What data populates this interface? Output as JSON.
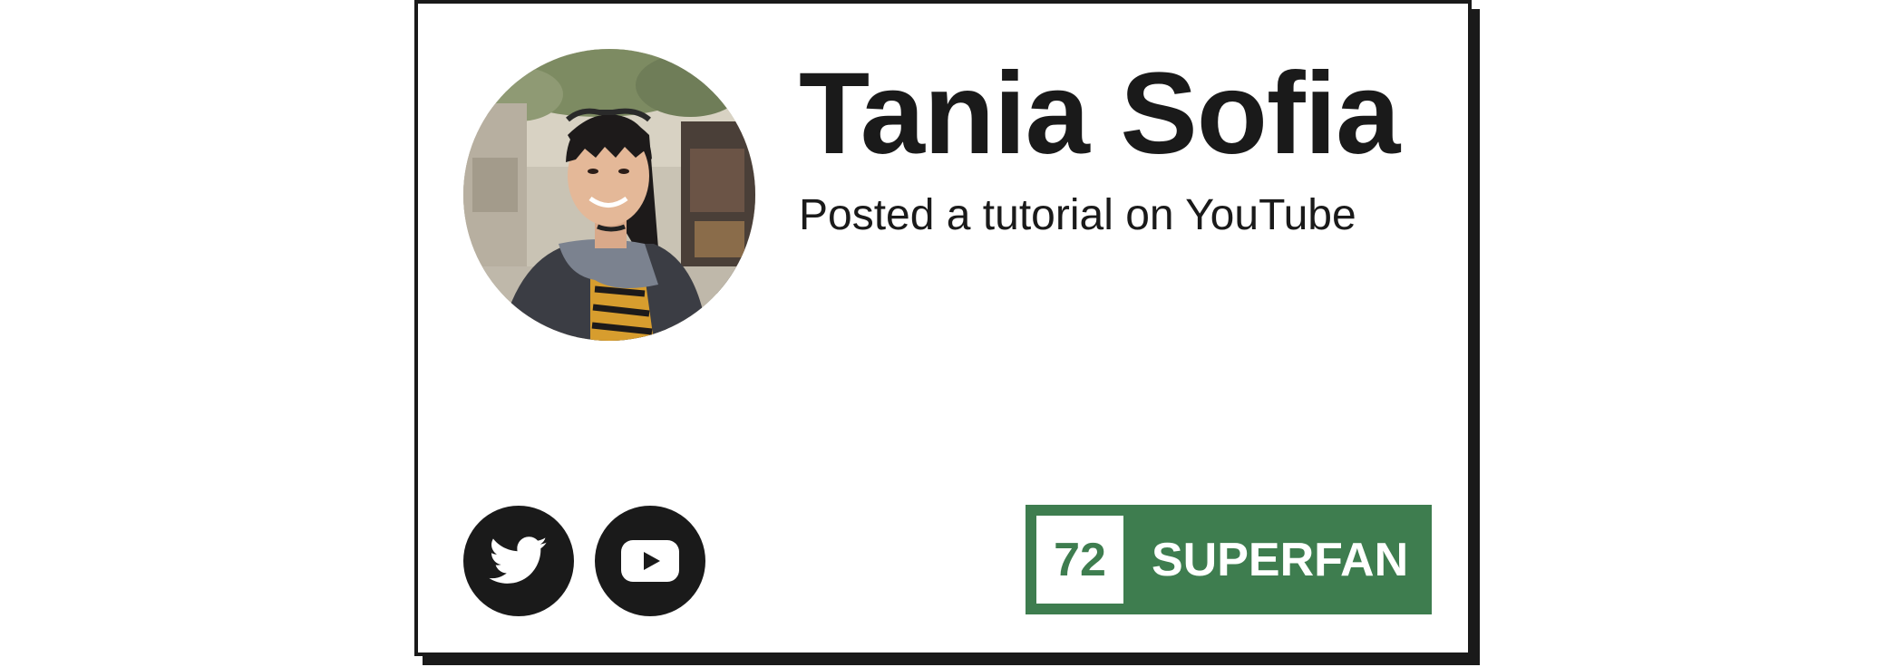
{
  "card": {
    "name": "Tania Sofia",
    "activity": "Posted a tutorial on YouTube",
    "avatar_alt": "Profile photo",
    "socials": [
      {
        "network": "Twitter",
        "icon": "twitter-icon"
      },
      {
        "network": "YouTube",
        "icon": "youtube-icon"
      }
    ],
    "badge": {
      "score": "72",
      "label": "SUPERFAN",
      "color": "#3e7d4f"
    }
  },
  "colors": {
    "ink": "#1a1a1a",
    "background": "#ffffff",
    "badge_green": "#3e7d4f"
  }
}
